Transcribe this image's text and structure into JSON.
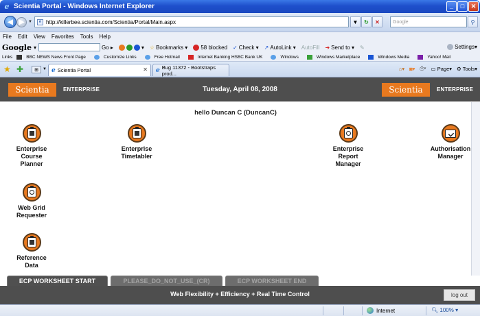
{
  "window": {
    "title": "Scientia Portal - Windows Internet Explorer"
  },
  "address": {
    "url": "http://killerbee.scientia.com/Scientia/Portal/Main.aspx",
    "search_placeholder": "Google"
  },
  "menu": {
    "items": [
      "File",
      "Edit",
      "View",
      "Favorites",
      "Tools",
      "Help"
    ]
  },
  "google_toolbar": {
    "logo": "Google",
    "go_label": "Go",
    "bookmarks_label": "Bookmarks",
    "blocked_label": "58 blocked",
    "check_label": "Check",
    "autolink_label": "AutoLink",
    "autofill_label": "AutoFill",
    "sendto_label": "Send to",
    "settings_label": "Settings"
  },
  "links_bar": {
    "label": "Links",
    "items": [
      "BBC NEWS News Front Page",
      "Customize Links",
      "Free Hotmail",
      "Internet Banking HSBC Bank UK",
      "Windows",
      "Windows Marketplace",
      "Windows Media",
      "Yahoo! Mail"
    ]
  },
  "tabs": [
    {
      "label": "Scientia Portal"
    },
    {
      "label": "Bug 11372 - Bootstraps prod..."
    }
  ],
  "tab_tools": {
    "page_label": "Page",
    "tools_label": "Tools"
  },
  "header": {
    "logo_text": "Scientia",
    "enterprise_label": "ENTERPRISE",
    "date": "Tuesday, April 08, 2008"
  },
  "main": {
    "greeting": "hello Duncan C (DuncanC)",
    "apps": [
      {
        "label": "Enterprise\nCourse\nPlanner"
      },
      {
        "label": "Enterprise\nTimetabler"
      },
      {
        "label": "Enterprise\nReport\nManager"
      },
      {
        "label": "Authorisation\nManager"
      },
      {
        "label": "Web Grid\nRequester"
      },
      {
        "label": "Reference\nData"
      }
    ]
  },
  "worksheet_tabs": [
    {
      "label": "ECP WORKSHEET START"
    },
    {
      "label": "PLEASE_DO_NOT_USE_(CR)"
    },
    {
      "label": "ECP WORKSHEET END"
    }
  ],
  "footer": {
    "tagline": "Web Flexibility + Efficiency + Real Time Control",
    "logout_label": "log out"
  },
  "status_bar": {
    "zone": "Internet",
    "zoom": "100%"
  },
  "colors": {
    "accent_orange": "#e8791f",
    "header_gray": "#4e4e4e"
  }
}
